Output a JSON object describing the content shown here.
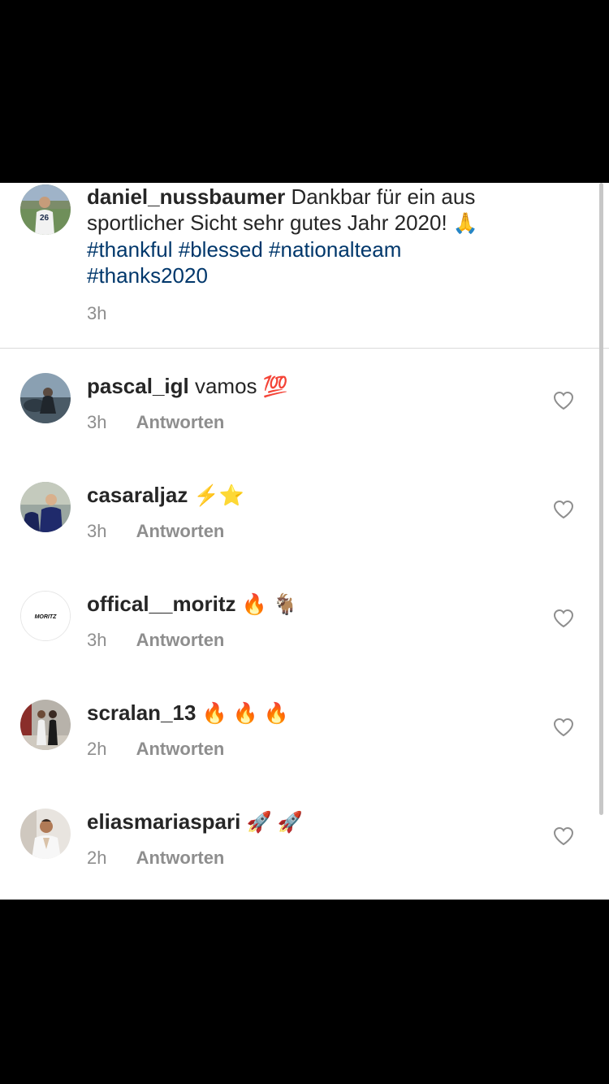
{
  "caption": {
    "username": "daniel_nussbaumer",
    "text_part1": "Dankbar für ein aus",
    "text_part2": "sportlicher Sicht sehr gutes Jahr 2020!",
    "emoji": "🙏",
    "hashtags_line1": "#thankful #blessed #nationalteam",
    "hashtags_line2": "#thanks2020",
    "time": "3h"
  },
  "comments": [
    {
      "username": "pascal_igl",
      "text": "vamos",
      "emoji": "💯",
      "time": "3h",
      "reply_label": "Antworten"
    },
    {
      "username": "casaraljaz",
      "text": "",
      "emoji": "⚡️⭐️",
      "time": "3h",
      "reply_label": "Antworten"
    },
    {
      "username": "offical__moritz",
      "text": "",
      "emoji": "🔥 🐐",
      "time": "3h",
      "reply_label": "Antworten"
    },
    {
      "username": "scralan_13",
      "text": "",
      "emoji": "🔥 🔥 🔥",
      "time": "2h",
      "reply_label": "Antworten"
    },
    {
      "username": "eliasmariaspari",
      "text": "",
      "emoji": "🚀 🚀",
      "time": "2h",
      "reply_label": "Antworten"
    }
  ],
  "avatar_moritz_logo": "MORITZ",
  "icons": {
    "like": "heart-outline-icon"
  },
  "colors": {
    "hashtag": "#00376b",
    "secondary_text": "#8e8e8e",
    "primary_text": "#262626"
  }
}
